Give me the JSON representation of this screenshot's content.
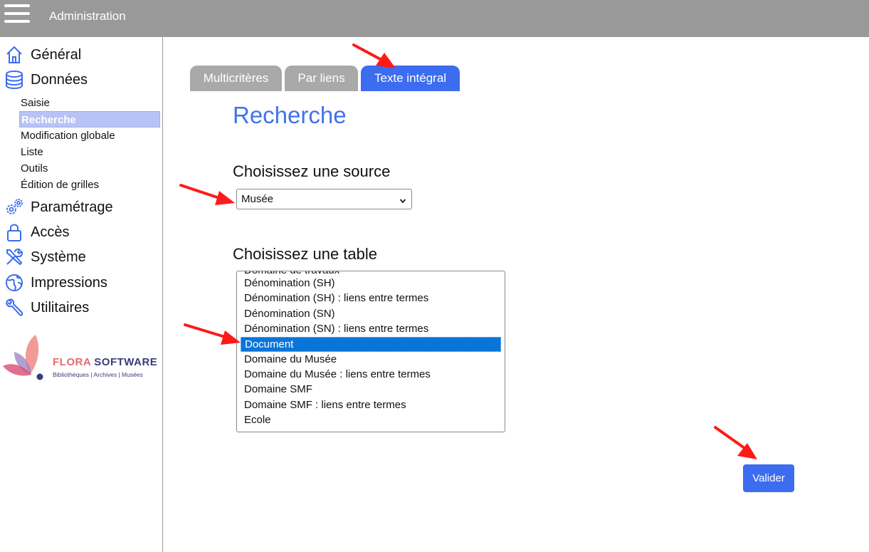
{
  "header": {
    "menu_icon": "hamburger-menu-icon",
    "title": "Administration"
  },
  "sidebar": {
    "sections": [
      {
        "label": "Général",
        "icon": "home-icon"
      },
      {
        "label": "Données",
        "icon": "database-icon"
      },
      {
        "label": "Paramétrage",
        "icon": "gears-icon"
      },
      {
        "label": "Accès",
        "icon": "lock-icon"
      },
      {
        "label": "Système",
        "icon": "tools-icon"
      },
      {
        "label": "Impressions",
        "icon": "globe-icon"
      },
      {
        "label": "Utilitaires",
        "icon": "wrench-icon"
      }
    ],
    "donnees_items": [
      {
        "label": "Saisie"
      },
      {
        "label": "Recherche",
        "active": true
      },
      {
        "label": "Modification globale"
      },
      {
        "label": "Liste"
      },
      {
        "label": "Outils"
      },
      {
        "label": "Édition de grilles"
      }
    ],
    "logo": {
      "brand_first": "FLORA",
      "brand_second": "SOFTWARE",
      "tagline": "Bibliothèques | Archives | Musées"
    }
  },
  "tabs": [
    {
      "label": "Multicritères",
      "active": false
    },
    {
      "label": "Par liens",
      "active": false
    },
    {
      "label": "Texte intégral",
      "active": true
    }
  ],
  "main": {
    "title": "Recherche",
    "source_label": "Choisissez une source",
    "source_value": "Musée",
    "table_label": "Choisissez une table",
    "table_options": [
      {
        "label": "Domaine de travaux"
      },
      {
        "label": "Dénomination (SH)"
      },
      {
        "label": "Dénomination (SH) : liens entre termes"
      },
      {
        "label": "Dénomination (SN)"
      },
      {
        "label": "Dénomination (SN) : liens entre termes"
      },
      {
        "label": "Document",
        "selected": true
      },
      {
        "label": "Domaine du Musée"
      },
      {
        "label": "Domaine du Musée : liens entre termes"
      },
      {
        "label": "Domaine SMF"
      },
      {
        "label": "Domaine SMF : liens entre termes"
      },
      {
        "label": "Ecole"
      }
    ],
    "submit_label": "Valider"
  },
  "colors": {
    "topbar": "#999999",
    "accent": "#3c6df0",
    "title": "#4172ec",
    "selection": "#0a75d8",
    "tab_inactive": "#a9a9a9",
    "annotation_arrow": "#ff1a1a"
  }
}
